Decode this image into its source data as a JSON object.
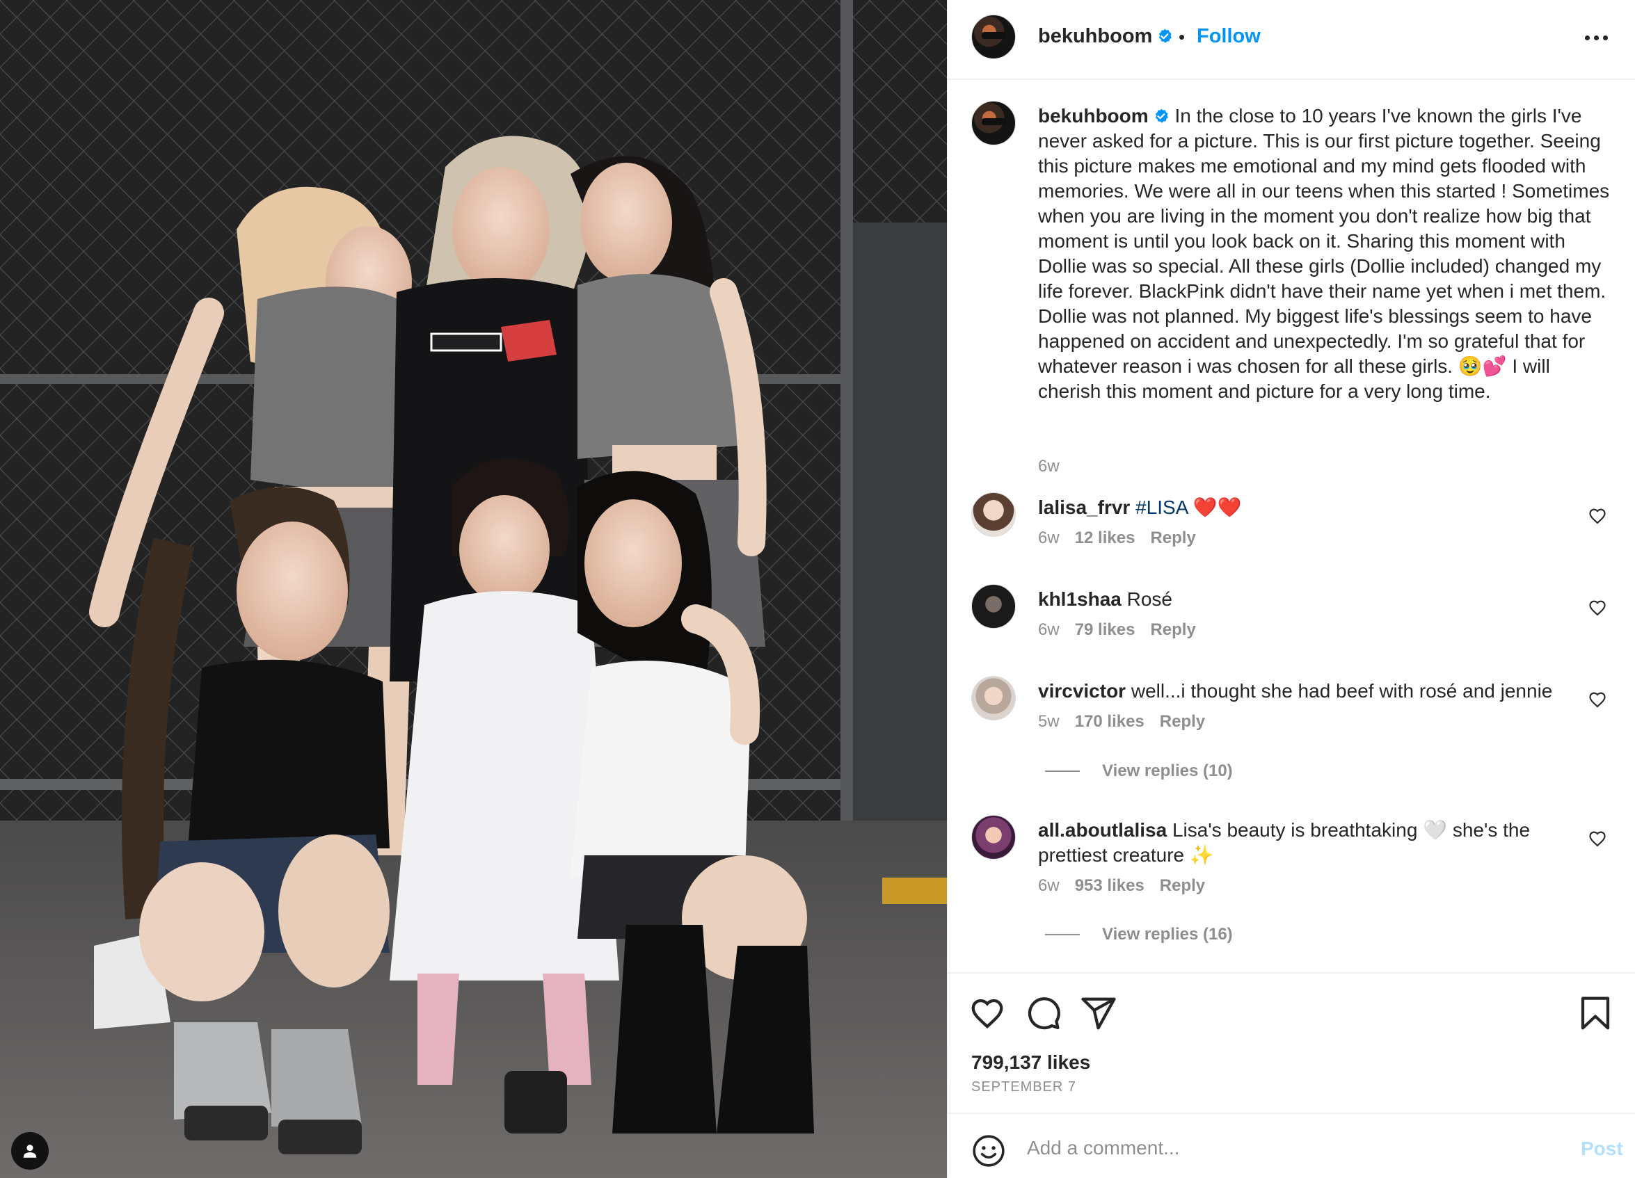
{
  "post": {
    "username": "bekuhboom",
    "follow_label": "Follow",
    "separator": "•",
    "caption": "In the close to 10 years I've known the girls I've never asked for a picture. This is our first picture together. Seeing this picture makes me emotional and my mind gets flooded with memories. We were all in our teens when this started ! Sometimes when you are living in the moment you don't realize how big that moment is until you look back on it. Sharing this moment with Dollie was so special. All these girls (Dollie included) changed my life forever. BlackPink didn't have their name yet when i met them. Dollie was not planned. My biggest life's blessings seem to have happened on accident and unexpectedly. I'm so grateful that for whatever reason i was chosen for all these girls. 🥹💕 I will cherish this moment and picture for a very long time.",
    "caption_time": "6w",
    "likes": "799,137 likes",
    "date": "SEPTEMBER 7"
  },
  "comments": [
    {
      "username": "lalisa_frvr",
      "text": "#LISA ❤️❤️",
      "time": "6w",
      "likes": "12 likes",
      "reply": "Reply"
    },
    {
      "username": "khl1shaa",
      "text": "Rosé",
      "time": "6w",
      "likes": "79 likes",
      "reply": "Reply"
    },
    {
      "username": "vircvictor",
      "text": "well...i thought she had beef with rosé and jennie",
      "time": "5w",
      "likes": "170 likes",
      "reply": "Reply",
      "view_replies": "View replies (10)"
    },
    {
      "username": "all.aboutlalisa",
      "text": "Lisa's beauty is breathtaking 🤍 she's the prettiest creature ✨",
      "time": "6w",
      "likes": "953 likes",
      "reply": "Reply",
      "view_replies": "View replies (16)"
    }
  ],
  "composer": {
    "placeholder": "Add a comment...",
    "post_label": "Post"
  },
  "colors": {
    "accent": "#0095f6",
    "post_disabled": "#b2dffc",
    "secondary_text": "#8e8e8e"
  },
  "icons": [
    "more-icon",
    "verified-badge-icon",
    "heart-icon",
    "comment-icon",
    "share-icon",
    "bookmark-icon",
    "emoji-icon",
    "tagged-user-icon"
  ]
}
